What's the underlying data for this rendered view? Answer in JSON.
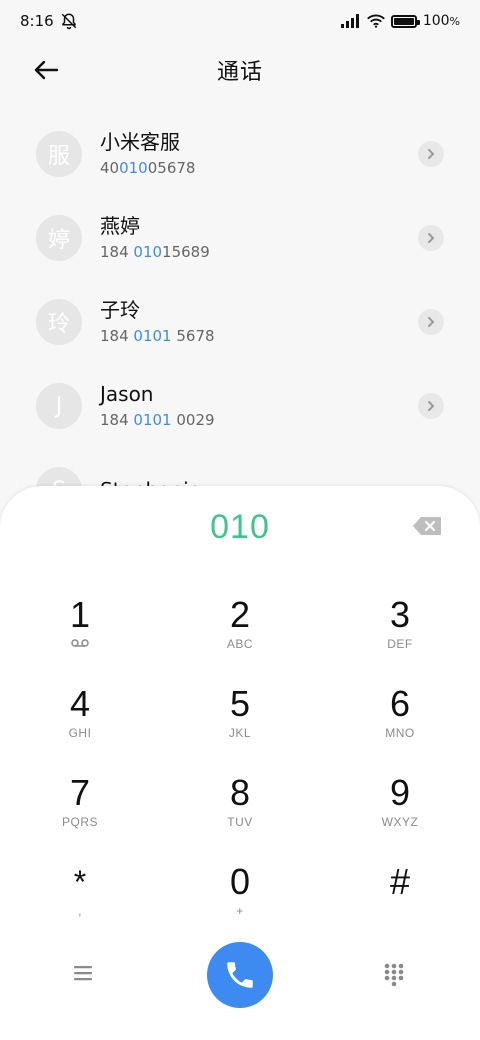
{
  "status_bar": {
    "time": "8:16",
    "battery": "100"
  },
  "header": {
    "title": "通话"
  },
  "contacts": [
    {
      "avatar": "服",
      "name": "小米客服",
      "number_pre": "40",
      "number_hl": "010",
      "number_post": "05678"
    },
    {
      "avatar": "婷",
      "name": "燕婷",
      "number_pre": "184 ",
      "number_hl": "010",
      "number_post": "15689"
    },
    {
      "avatar": "玲",
      "name": "子玲",
      "number_pre": "184 ",
      "number_hl": "0101",
      "number_post": " 5678"
    },
    {
      "avatar": "J",
      "name": "Jason",
      "number_pre": "184 ",
      "number_hl": "0101",
      "number_post": " 0029"
    },
    {
      "avatar": "S",
      "name": "Stephanie",
      "number_pre": "",
      "number_hl": "",
      "number_post": ""
    }
  ],
  "dialer": {
    "entered_number": "010",
    "keys": [
      {
        "digit": "1",
        "letters": ""
      },
      {
        "digit": "2",
        "letters": "ABC"
      },
      {
        "digit": "3",
        "letters": "DEF"
      },
      {
        "digit": "4",
        "letters": "GHI"
      },
      {
        "digit": "5",
        "letters": "JKL"
      },
      {
        "digit": "6",
        "letters": "MNO"
      },
      {
        "digit": "7",
        "letters": "PQRS"
      },
      {
        "digit": "8",
        "letters": "TUV"
      },
      {
        "digit": "9",
        "letters": "WXYZ"
      },
      {
        "digit": "*",
        "letters": ","
      },
      {
        "digit": "0",
        "letters": "+"
      },
      {
        "digit": "#",
        "letters": ""
      }
    ]
  },
  "colors": {
    "accent_green": "#3ec58f",
    "call_blue": "#3d8bf0",
    "highlight_blue": "#3f8ce6"
  },
  "icons": {
    "back": "arrow-left-icon",
    "delete": "backspace-icon",
    "menu": "menu-icon",
    "call": "phone-icon",
    "keypad": "keypad-icon",
    "voicemail": "voicemail-icon",
    "mute": "bell-off-icon"
  }
}
